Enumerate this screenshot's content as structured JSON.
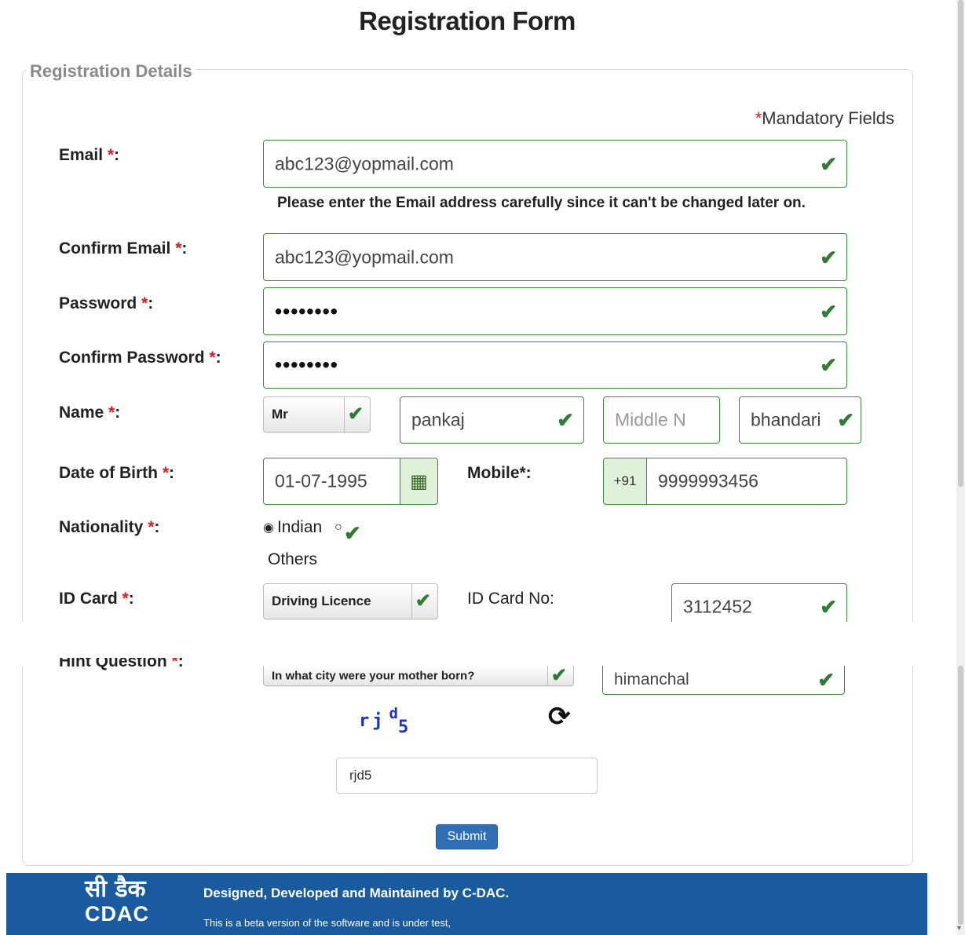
{
  "page": {
    "title": "Registration Form"
  },
  "form": {
    "legend": "Registration Details",
    "mandatory_star": "*",
    "mandatory_text": "Mandatory Fields",
    "email": {
      "label": "Email",
      "value": "abc123@yopmail.com"
    },
    "email_note": "Please enter the Email address carefully since it can't be changed later on.",
    "confirm_email": {
      "label": "Confirm Email",
      "value": "abc123@yopmail.com"
    },
    "password": {
      "label": "Password",
      "value": "••••••••"
    },
    "confirm_password": {
      "label": "Confirm Password",
      "value": "••••••••"
    },
    "name": {
      "label": "Name",
      "title_value": "Mr",
      "first": "pankaj",
      "middle_placeholder": "Middle N",
      "last": "bhandari"
    },
    "dob": {
      "label": "Date of Birth",
      "value": "01-07-1995"
    },
    "mobile": {
      "label": "Mobile*:",
      "prefix": "+91",
      "value": "9999993456"
    },
    "nationality": {
      "label": "Nationality",
      "option1": "Indian",
      "option2": "Others",
      "selected": "Indian"
    },
    "id_card": {
      "label": "ID Card",
      "value": "Driving Licence"
    },
    "id_card_no": {
      "label": "ID Card No:",
      "value": "3112452"
    },
    "hint_question": {
      "label": "Hint Question",
      "value": "In what city were your mother born?"
    },
    "hint_answer": {
      "value": "himanchal"
    },
    "captcha": {
      "chars": [
        "r",
        "j",
        "d",
        "5"
      ],
      "input_value": "rjd5"
    },
    "label_suffix": ":",
    "submit_label": "Submit"
  },
  "footer": {
    "logo_hindi": "सी डैक",
    "logo_en": "CDAC",
    "line1": "Designed, Developed and Maintained by C-DAC.",
    "line2": "This is a beta version of the software and is under test,"
  },
  "colors": {
    "check_green": "#2e7d32",
    "footer_blue": "#1a5ba0",
    "button_blue": "#2f6fb5",
    "required_red": "#e21b1b"
  },
  "icons": [
    "check-icon",
    "calendar-icon",
    "refresh-icon",
    "radio-icon",
    "scroll-down-icon"
  ]
}
